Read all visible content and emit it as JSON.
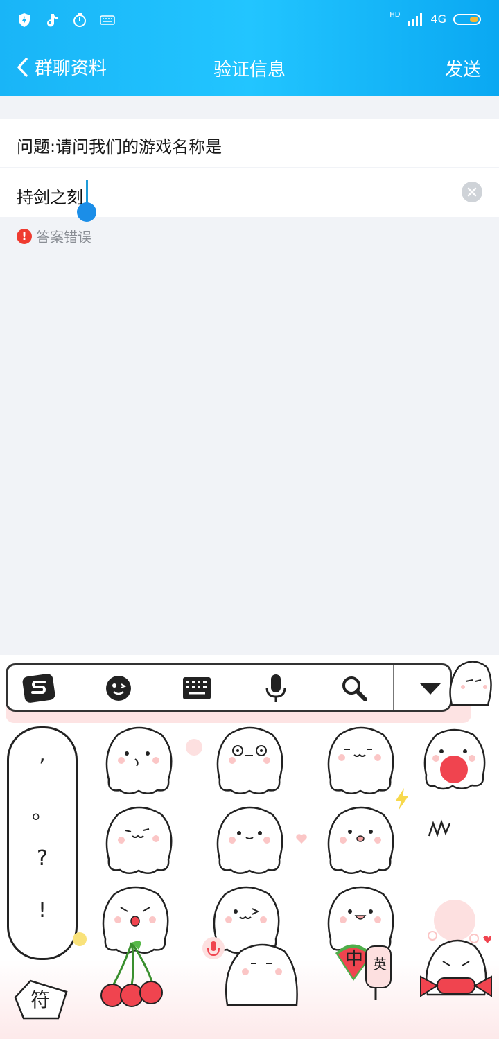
{
  "status": {
    "network": "4G",
    "hd": "HD"
  },
  "nav": {
    "back_label": "群聊资料",
    "title": "验证信息",
    "send_label": "发送"
  },
  "form": {
    "question": "问题:请问我们的游戏名称是",
    "answer": "持剑之刻",
    "error": "答案错误"
  },
  "keyboard": {
    "symbols": [
      ",",
      "。",
      "?",
      "!"
    ],
    "fu_label": "符",
    "zh_label": "中",
    "en_label": "英",
    "accent": "#ef3b30",
    "header_gradient": [
      "#19b5f7",
      "#0aa8f2"
    ]
  }
}
